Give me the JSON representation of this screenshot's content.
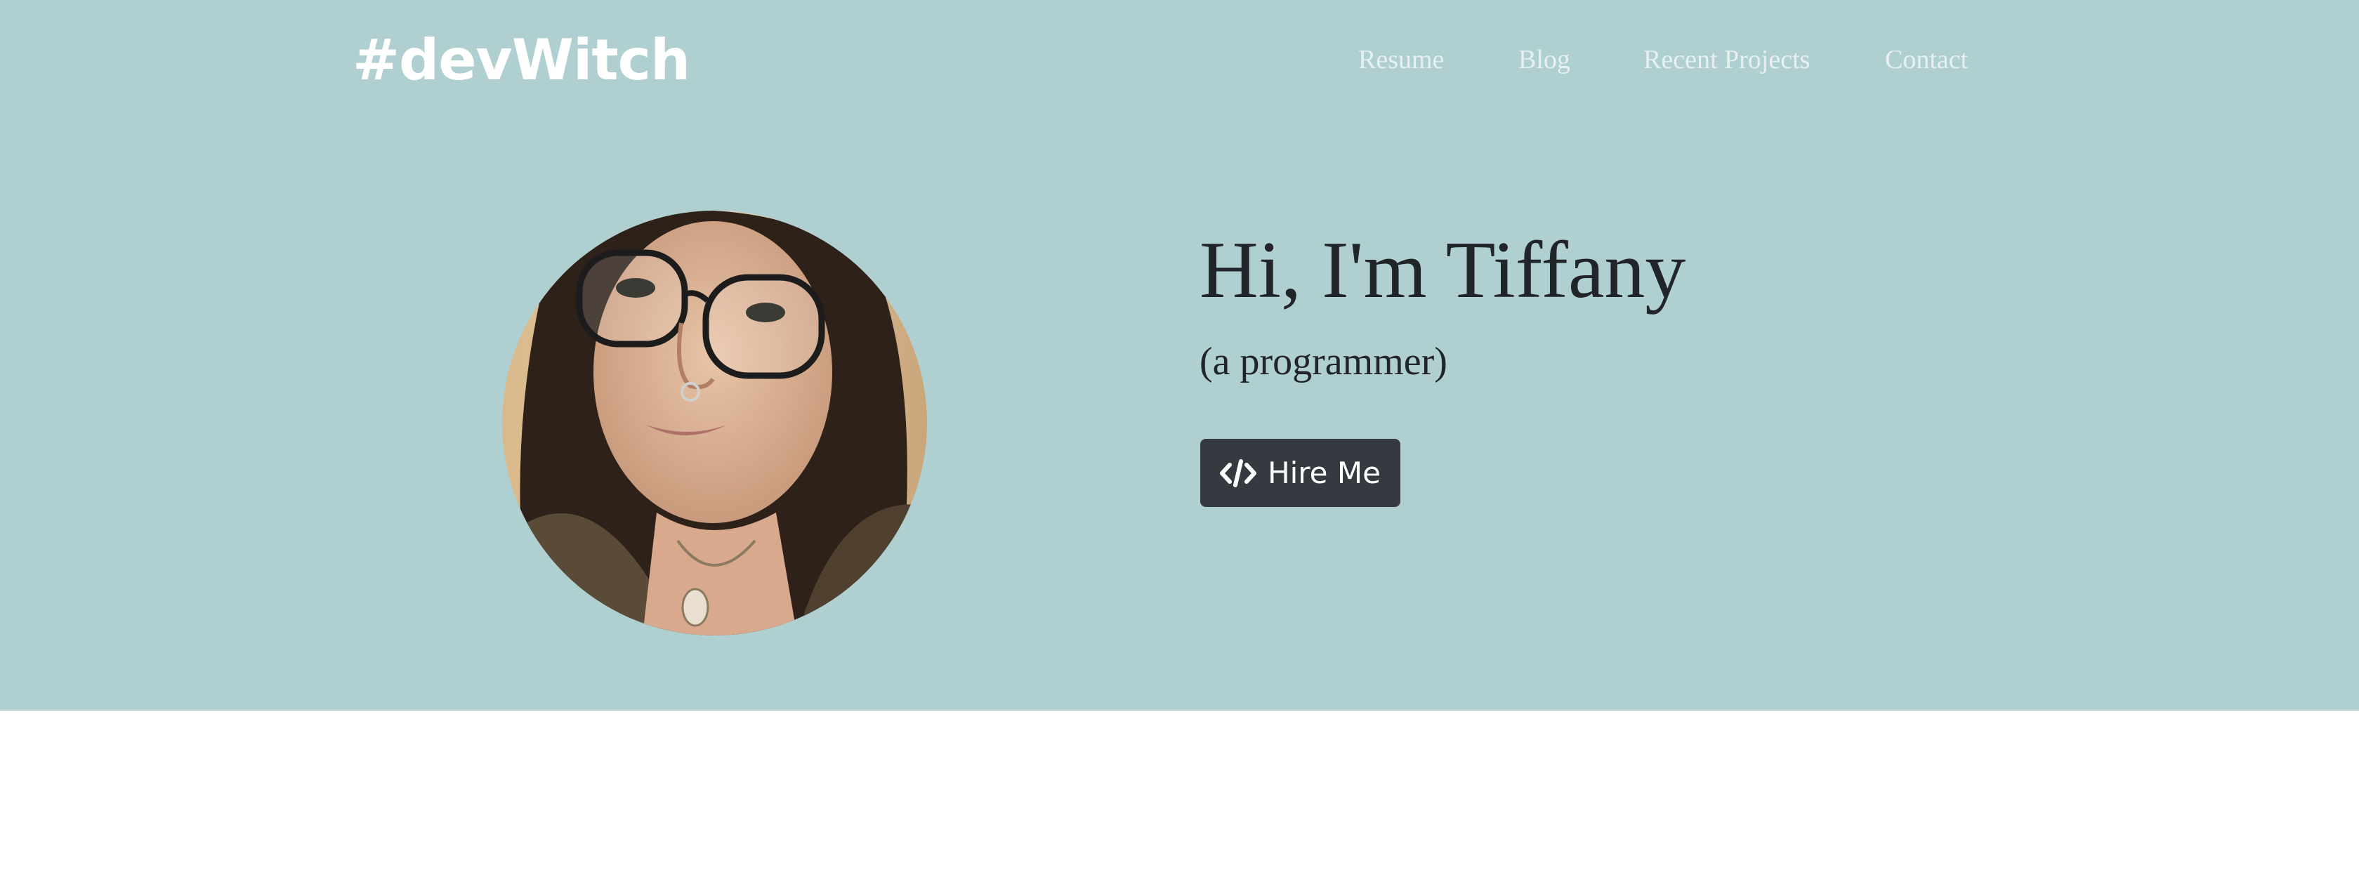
{
  "brand": {
    "name": "#devWitch"
  },
  "nav": {
    "items": [
      {
        "label": "Resume"
      },
      {
        "label": "Blog"
      },
      {
        "label": "Recent Projects"
      },
      {
        "label": "Contact"
      }
    ]
  },
  "hero": {
    "headline": "Hi, I'm Tiffany",
    "subheadline": "(a programmer)",
    "cta": {
      "label": "Hire Me",
      "icon": "code-icon"
    },
    "avatar": {
      "icon": "profile-photo"
    }
  },
  "colors": {
    "hero_background": "#b0cfd0",
    "button_background": "#343a40",
    "text_dark": "#212529",
    "nav_text": "#e6f0f0"
  }
}
